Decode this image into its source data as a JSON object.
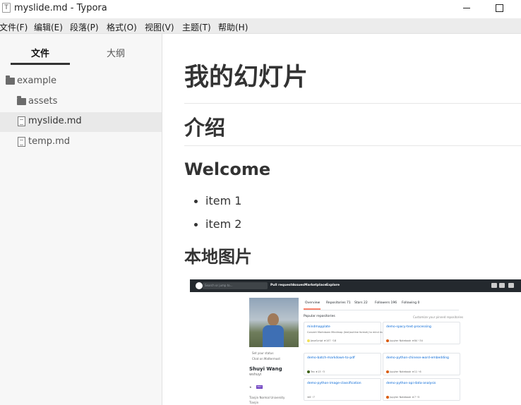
{
  "window": {
    "app_icon": "T",
    "title": "myslide.md - Typora"
  },
  "menu": [
    "文件(F)",
    "编辑(E)",
    "段落(P)",
    "格式(O)",
    "视图(V)",
    "主题(T)",
    "帮助(H)"
  ],
  "sidebar": {
    "tabs": [
      "文件",
      "大纲"
    ],
    "tree": [
      {
        "label": "example",
        "icon": "folder-icon"
      },
      {
        "label": "assets",
        "icon": "folder-icon"
      },
      {
        "label": "myslide.md",
        "icon": "file-icon",
        "active": true
      },
      {
        "label": "temp.md",
        "icon": "file-icon"
      }
    ]
  },
  "doc": {
    "h1": "我的幻灯片",
    "h2": "介绍",
    "h3_welcome": "Welcome",
    "items": [
      "item 1",
      "item 2"
    ],
    "h3_image": "本地图片"
  },
  "embedded_github": {
    "search_placeholder": "Search or jump to...",
    "nav": [
      "Pull requests",
      "Issues",
      "Marketplace",
      "Explore"
    ],
    "tabs": [
      "Overview",
      "Repositories 71",
      "Stars 22",
      "Followers 196",
      "Following 0"
    ],
    "popular_title": "Popular repositories",
    "customize": "Customize your pinned repositories",
    "status_lines": [
      "Set your status",
      "Chat on Mattermost"
    ],
    "name": "Shuyi Wang",
    "login": "wshuyi",
    "pro_badge": "PRO",
    "affiliation": "Tianjin Normal University",
    "location": "Tianjin",
    "repos": [
      {
        "name": "mindmapplate",
        "desc": "Convert Markdown Mindmap (text/outline format) to mind map slides",
        "lang": "JavaScript",
        "lang_color": "#f1e05a",
        "stars": "107",
        "forks": "18"
      },
      {
        "name": "demo-spacy-text-processing",
        "desc": "",
        "lang": "Jupyter Notebook",
        "lang_color": "#DA5B0B",
        "stars": "84",
        "forks": "34"
      },
      {
        "name": "demo-batch-markdown-to-pdf",
        "desc": "",
        "lang": "Tex",
        "lang_color": "#3D6117",
        "stars": "13",
        "forks": "3"
      },
      {
        "name": "demo-python-chinese-word-embedding",
        "desc": "",
        "lang": "Jupyter Notebook",
        "lang_color": "#DA5B0B",
        "stars": "11",
        "forks": "6"
      },
      {
        "name": "demo-python-image-classification",
        "desc": "",
        "lang": "",
        "lang_color": "",
        "stars": "8",
        "forks": "7"
      },
      {
        "name": "demo-python-api-data-analysis",
        "desc": "",
        "lang": "Jupyter Notebook",
        "lang_color": "#DA5B0B",
        "stars": "7",
        "forks": "5"
      }
    ]
  }
}
